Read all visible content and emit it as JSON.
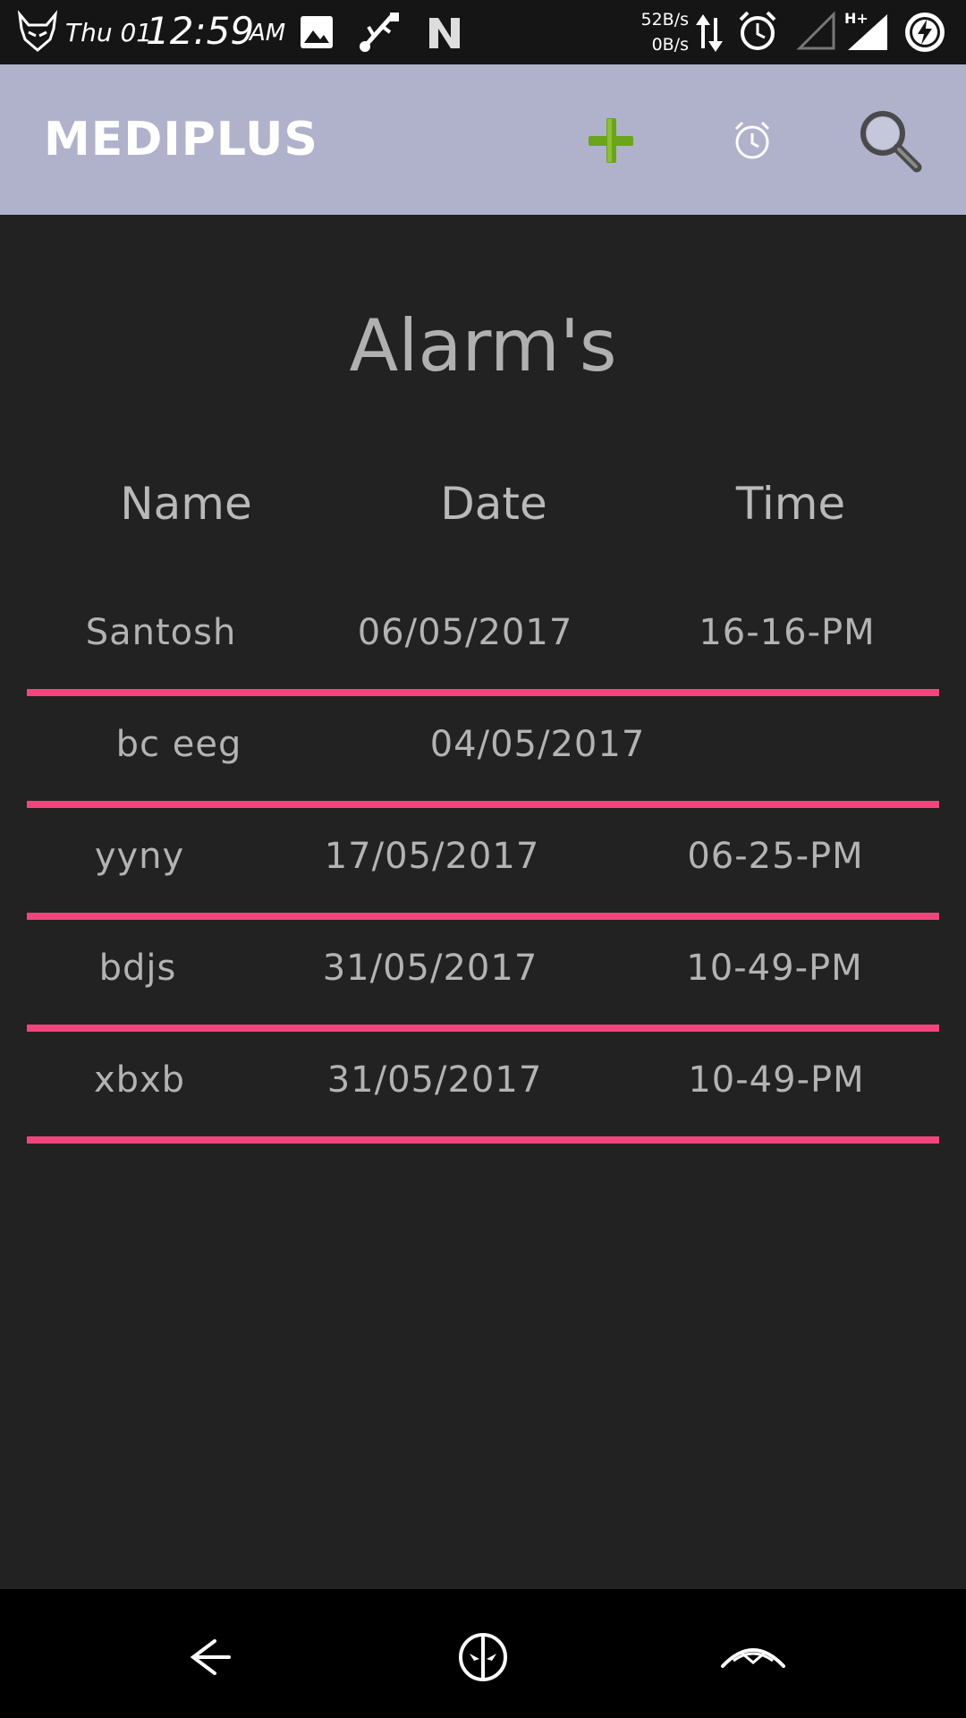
{
  "status_bar": {
    "day": "Thu 01",
    "time": "12:59",
    "ampm": "AM",
    "speed_up": "52B/s",
    "speed_down": "0B/s",
    "icons": [
      "devil-logo-icon",
      "image-icon",
      "usb-icon",
      "n-logo-icon",
      "data-transfer-icon",
      "alarm-icon",
      "signal-empty-icon",
      "signal-hplus-icon",
      "battery-charging-icon"
    ]
  },
  "app_bar": {
    "title": "MEDIPLUS",
    "actions": [
      "add-icon",
      "alarm-icon",
      "search-icon"
    ],
    "add_color": "#6aa51a"
  },
  "page": {
    "title": "Alarm's"
  },
  "table": {
    "headers": [
      "Name",
      "Date",
      "Time"
    ],
    "rows": [
      {
        "name": "Santosh",
        "date": "06/05/2017",
        "time": "16-16-PM"
      },
      {
        "name": "bc eeg",
        "date": "04/05/2017",
        "time": ""
      },
      {
        "name": "yyny",
        "date": "17/05/2017",
        "time": "06-25-PM"
      },
      {
        "name": "bdjs",
        "date": "31/05/2017",
        "time": "10-49-PM"
      },
      {
        "name": "xbxb",
        "date": "31/05/2017",
        "time": "10-49-PM"
      }
    ],
    "divider_color": "#f0457d"
  },
  "nav_bar": {
    "buttons": [
      "back-icon",
      "home-icon",
      "recents-icon"
    ]
  }
}
